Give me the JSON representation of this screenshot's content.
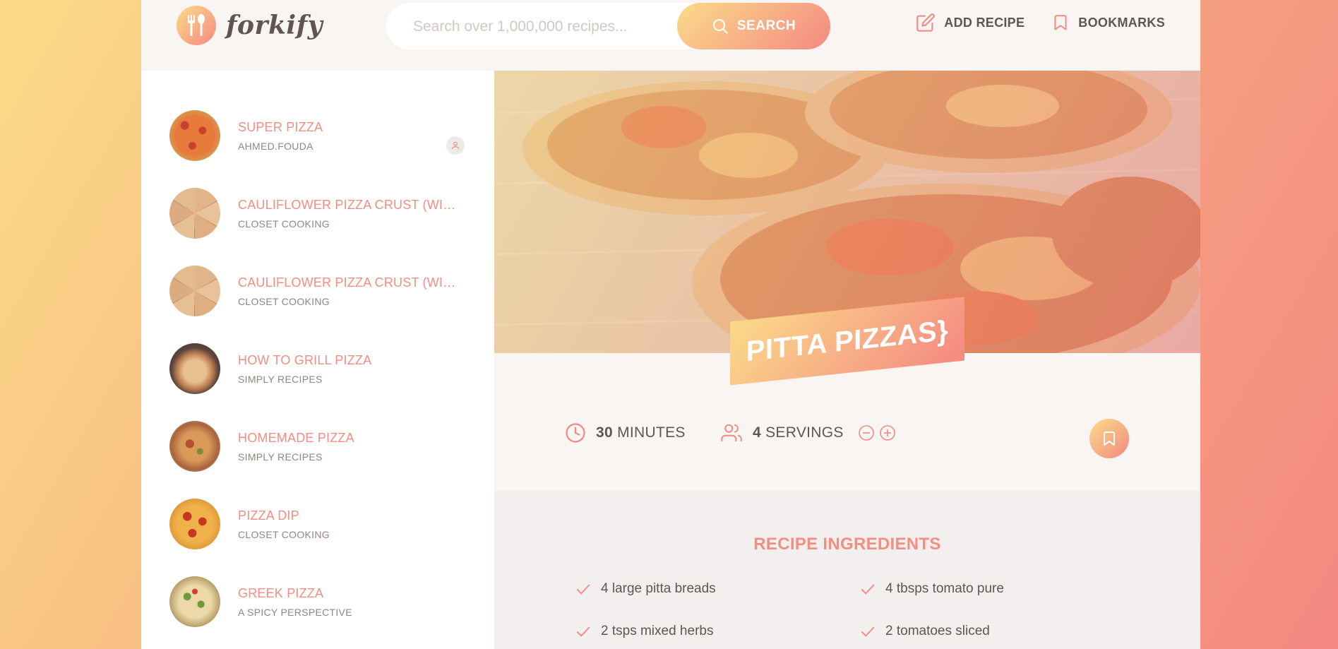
{
  "header": {
    "logo_text": "forkify",
    "search_placeholder": "Search over 1,000,000 recipes...",
    "search_button": "SEARCH",
    "nav": [
      {
        "label": "ADD RECIPE",
        "icon": "edit-icon"
      },
      {
        "label": "BOOKMARKS",
        "icon": "bookmark-icon"
      }
    ]
  },
  "results": [
    {
      "title": "SUPER PIZZA",
      "publisher": "AHMED.FOUDA",
      "user_generated": true
    },
    {
      "title": "CAULIFLOWER PIZZA CRUST (WITH BBQ CHICKEN PIZZA)",
      "publisher": "CLOSET COOKING"
    },
    {
      "title": "CAULIFLOWER PIZZA CRUST (WITH BBQ CHICKEN PIZZA)",
      "publisher": "CLOSET COOKING"
    },
    {
      "title": "HOW TO GRILL PIZZA",
      "publisher": "SIMPLY RECIPES"
    },
    {
      "title": "HOMEMADE PIZZA",
      "publisher": "SIMPLY RECIPES"
    },
    {
      "title": "PIZZA DIP",
      "publisher": "CLOSET COOKING"
    },
    {
      "title": "GREEK PIZZA",
      "publisher": "A SPICY PERSPECTIVE"
    }
  ],
  "recipe": {
    "title": "PITTA PIZZAS}",
    "cooking_time": "30",
    "cooking_time_unit": "MINUTES",
    "servings": "4",
    "servings_unit": "SERVINGS",
    "ingredients_heading": "RECIPE INGREDIENTS",
    "ingredients": [
      "4 large pitta breads",
      "4 tbsps tomato pure",
      "2 tsps mixed herbs",
      "2 tomatoes sliced"
    ]
  },
  "colors": {
    "accent_start": "#fbdb89",
    "accent_end": "#f48982",
    "title_text": "#f38e82",
    "body_text": "#615551"
  }
}
